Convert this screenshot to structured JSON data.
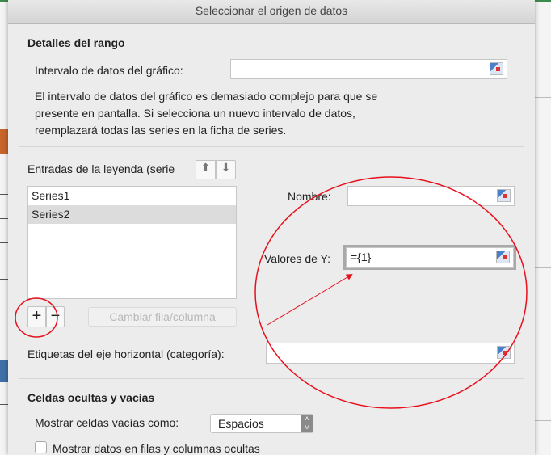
{
  "dialog": {
    "title": "Seleccionar el origen de datos"
  },
  "range": {
    "heading": "Detalles del rango",
    "interval_label": "Intervalo de datos del gráfico:",
    "interval_value": "",
    "message": [
      "El intervalo de datos del gráfico es demasiado complejo para que se",
      "presente en pantalla. Si selecciona un nuevo intervalo de datos,",
      "reemplazará todas las series en la ficha de series."
    ]
  },
  "legend": {
    "label": "Entradas de la leyenda (serie",
    "series": [
      {
        "label": "Series1"
      },
      {
        "label": "Series2",
        "selected": true
      }
    ],
    "add": "+",
    "remove": "−",
    "switch_label": "Cambiar fila/columna"
  },
  "series_edit": {
    "name_label": "Nombre:",
    "name_value": "",
    "y_label": "Valores de Y:",
    "y_value": "={1}"
  },
  "category": {
    "label": "Etiquetas del eje horizontal (categoría):",
    "value": ""
  },
  "hidden": {
    "heading": "Celdas ocultas y vacías",
    "empty_label": "Mostrar celdas vacías como:",
    "empty_value": "Espacios",
    "show_hidden_label": "Mostrar datos en filas y columnas ocultas",
    "show_hidden_checked": false
  },
  "colors": {
    "annotation": "#e8101c",
    "accent": "#4a7fc9"
  }
}
